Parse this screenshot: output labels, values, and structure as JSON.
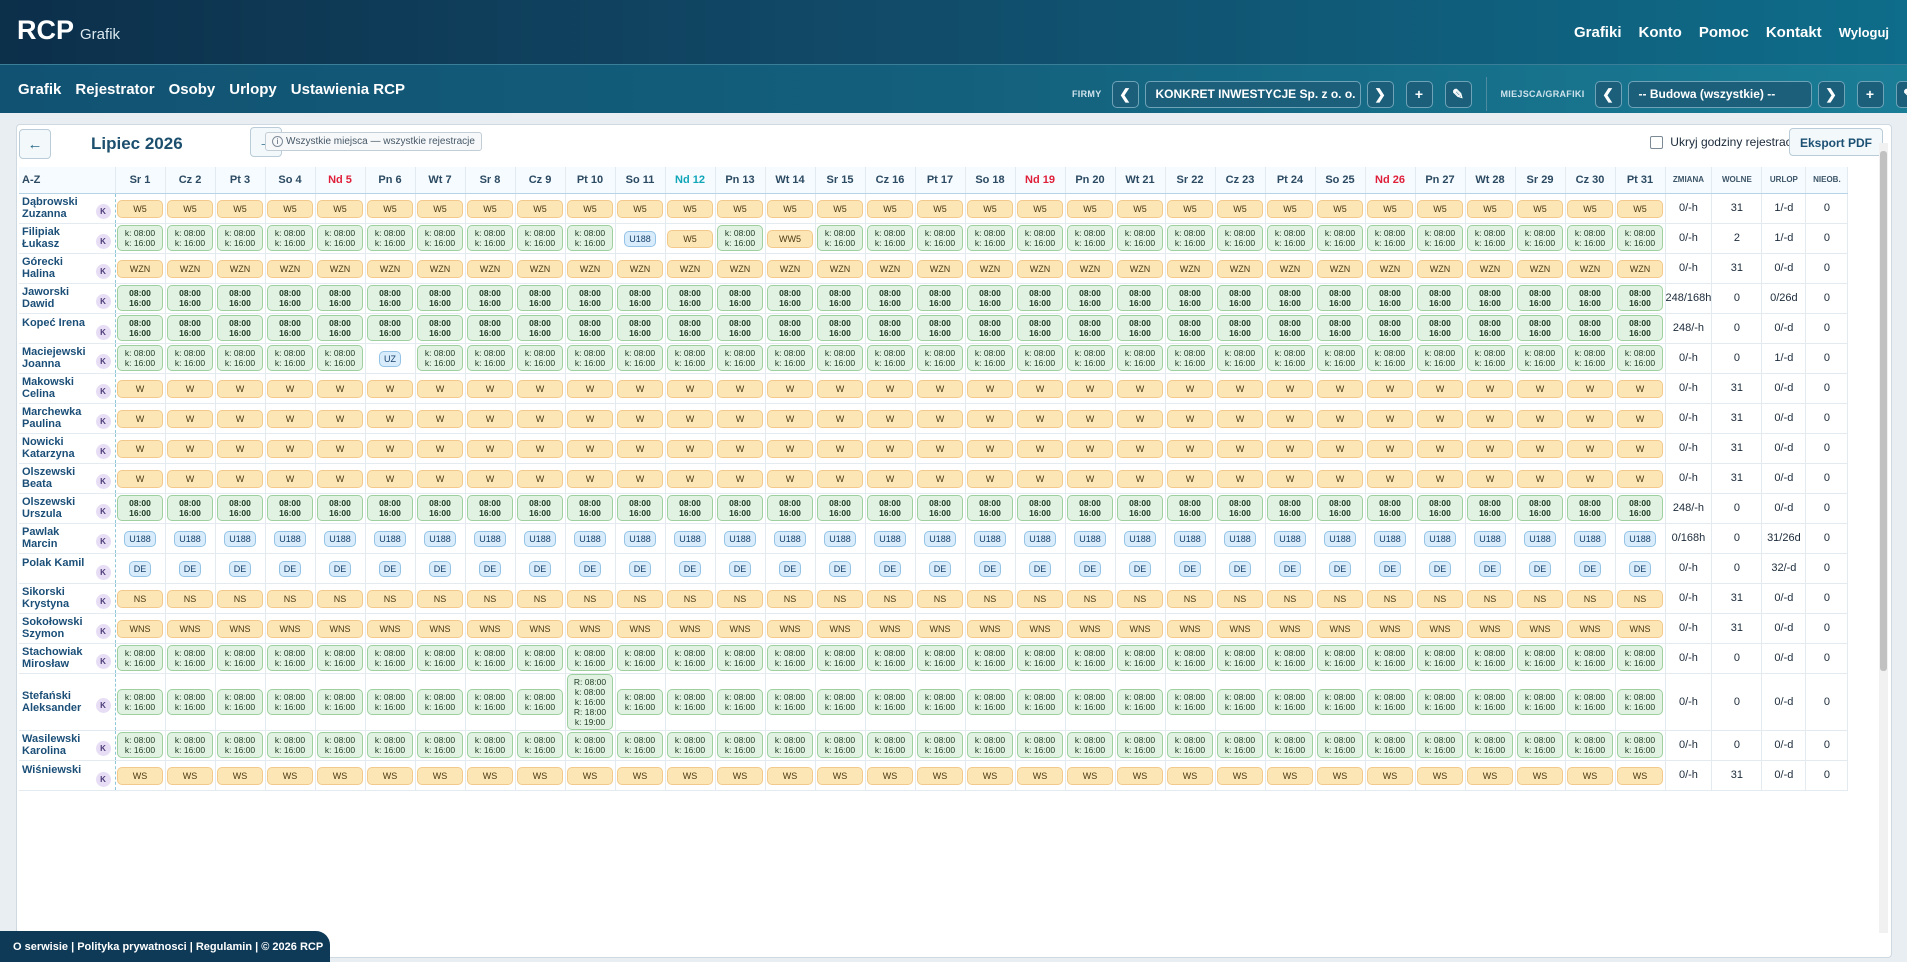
{
  "app": {
    "name": "RCP",
    "subtitle": "Grafik"
  },
  "topnav": [
    "Grafiki",
    "Konto",
    "Pomoc",
    "Kontakt",
    "Wyloguj"
  ],
  "subnav": [
    "Grafik",
    "Rejestrator",
    "Osoby",
    "Urlopy",
    "Ustawienia RCP"
  ],
  "controls": {
    "firmy_label": "FIRMY",
    "firma": "KONKRET INWESTYCJE Sp. z o. o.",
    "miejsca_label": "MIEJSCA/GRAFIKI",
    "miejsce": "-- Budowa (wszystkie) --",
    "prev": "❮",
    "next": "❯",
    "add": "+",
    "edit": "✎"
  },
  "calendar": {
    "month": "Lipiec 2026",
    "prev": "←",
    "next": "→",
    "badge": "Wszystkie miejsca — wszystkie rejestracje",
    "hide_hours": "Ukryj godziny rejestracji",
    "export": "Eksport PDF"
  },
  "columns": {
    "name": "A-Z",
    "summary": [
      "ZMIANA",
      "WOLNE",
      "URLOP",
      "NIEOB."
    ]
  },
  "days": [
    {
      "label": "Sr 1",
      "type": "n"
    },
    {
      "label": "Cz 2",
      "type": "n"
    },
    {
      "label": "Pt 3",
      "type": "n"
    },
    {
      "label": "So 4",
      "type": "n"
    },
    {
      "label": "Nd 5",
      "type": "sun"
    },
    {
      "label": "Pn 6",
      "type": "n"
    },
    {
      "label": "Wt 7",
      "type": "n"
    },
    {
      "label": "Sr 8",
      "type": "n"
    },
    {
      "label": "Cz 9",
      "type": "n"
    },
    {
      "label": "Pt 10",
      "type": "n"
    },
    {
      "label": "So 11",
      "type": "n"
    },
    {
      "label": "Nd 12",
      "type": "today"
    },
    {
      "label": "Pn 13",
      "type": "n"
    },
    {
      "label": "Wt 14",
      "type": "n"
    },
    {
      "label": "Sr 15",
      "type": "n"
    },
    {
      "label": "Cz 16",
      "type": "n"
    },
    {
      "label": "Pt 17",
      "type": "n"
    },
    {
      "label": "So 18",
      "type": "n"
    },
    {
      "label": "Nd 19",
      "type": "sun"
    },
    {
      "label": "Pn 20",
      "type": "n"
    },
    {
      "label": "Wt 21",
      "type": "n"
    },
    {
      "label": "Sr 22",
      "type": "n"
    },
    {
      "label": "Cz 23",
      "type": "n"
    },
    {
      "label": "Pt 24",
      "type": "n"
    },
    {
      "label": "So 25",
      "type": "n"
    },
    {
      "label": "Nd 26",
      "type": "sun"
    },
    {
      "label": "Pn 27",
      "type": "n"
    },
    {
      "label": "Wt 28",
      "type": "n"
    },
    {
      "label": "Sr 29",
      "type": "n"
    },
    {
      "label": "Cz 30",
      "type": "n"
    },
    {
      "label": "Pt 31",
      "type": "n"
    }
  ],
  "person_badge": "K",
  "cell_types": {
    "w": "yellow shift code",
    "g": "green k: shift",
    "g2": "green plain shift",
    "u": "blue absence"
  },
  "rows": [
    {
      "name": "Dąbrowski Zuzanna",
      "default": {
        "t": "w",
        "l": [
          "W5"
        ]
      },
      "overrides": {},
      "sum": [
        "0/-h",
        "31",
        "1/-d",
        "0"
      ]
    },
    {
      "name": "Filipiak Łukasz",
      "default": {
        "t": "g",
        "l": [
          "k: 08:00",
          "k: 16:00"
        ]
      },
      "overrides": {
        "10": {
          "t": "u",
          "l": [
            "U188"
          ]
        },
        "11": {
          "t": "w",
          "l": [
            "W5"
          ]
        },
        "13": {
          "t": "w",
          "l": [
            "WW5"
          ]
        }
      },
      "sum": [
        "0/-h",
        "2",
        "1/-d",
        "0"
      ]
    },
    {
      "name": "Górecki Halina",
      "default": {
        "t": "w",
        "l": [
          "WZN"
        ]
      },
      "overrides": {},
      "sum": [
        "0/-h",
        "31",
        "0/-d",
        "0"
      ]
    },
    {
      "name": "Jaworski Dawid",
      "default": {
        "t": "g2",
        "l": [
          "08:00",
          "16:00"
        ]
      },
      "overrides": {},
      "sum": [
        "248/168h",
        "0",
        "0/26d",
        "0"
      ]
    },
    {
      "name": "Kopeć Irena",
      "default": {
        "t": "g2",
        "l": [
          "08:00",
          "16:00"
        ]
      },
      "overrides": {},
      "sum": [
        "248/-h",
        "0",
        "0/-d",
        "0"
      ]
    },
    {
      "name": "Maciejewski Joanna",
      "default": {
        "t": "g",
        "l": [
          "k: 08:00",
          "k: 16:00"
        ]
      },
      "overrides": {
        "5": {
          "t": "u",
          "l": [
            "UZ"
          ]
        }
      },
      "sum": [
        "0/-h",
        "0",
        "1/-d",
        "0"
      ]
    },
    {
      "name": "Makowski Celina",
      "default": {
        "t": "w",
        "l": [
          "W"
        ]
      },
      "overrides": {},
      "sum": [
        "0/-h",
        "31",
        "0/-d",
        "0"
      ]
    },
    {
      "name": "Marchewka Paulina",
      "default": {
        "t": "w",
        "l": [
          "W"
        ]
      },
      "overrides": {},
      "sum": [
        "0/-h",
        "31",
        "0/-d",
        "0"
      ]
    },
    {
      "name": "Nowicki Katarzyna",
      "default": {
        "t": "w",
        "l": [
          "W"
        ]
      },
      "overrides": {},
      "sum": [
        "0/-h",
        "31",
        "0/-d",
        "0"
      ]
    },
    {
      "name": "Olszewski Beata",
      "default": {
        "t": "w",
        "l": [
          "W"
        ]
      },
      "overrides": {},
      "sum": [
        "0/-h",
        "31",
        "0/-d",
        "0"
      ]
    },
    {
      "name": "Olszewski Urszula",
      "default": {
        "t": "g2",
        "l": [
          "08:00",
          "16:00"
        ]
      },
      "overrides": {},
      "sum": [
        "248/-h",
        "0",
        "0/-d",
        "0"
      ]
    },
    {
      "name": "Pawlak Marcin",
      "default": {
        "t": "u",
        "l": [
          "U188"
        ]
      },
      "overrides": {},
      "sum": [
        "0/168h",
        "0",
        "31/26d",
        "0"
      ]
    },
    {
      "name": "Polak Kamil",
      "default": {
        "t": "u",
        "l": [
          "DE"
        ]
      },
      "overrides": {},
      "sum": [
        "0/-h",
        "0",
        "32/-d",
        "0"
      ]
    },
    {
      "name": "Sikorski Krystyna",
      "default": {
        "t": "w",
        "l": [
          "NS"
        ]
      },
      "overrides": {},
      "sum": [
        "0/-h",
        "31",
        "0/-d",
        "0"
      ]
    },
    {
      "name": "Sokołowski Szymon",
      "default": {
        "t": "w",
        "l": [
          "WNS"
        ]
      },
      "overrides": {},
      "sum": [
        "0/-h",
        "31",
        "0/-d",
        "0"
      ]
    },
    {
      "name": "Stachowiak Mirosław",
      "default": {
        "t": "g",
        "l": [
          "k: 08:00",
          "k: 16:00"
        ]
      },
      "overrides": {},
      "sum": [
        "0/-h",
        "0",
        "0/-d",
        "0"
      ]
    },
    {
      "name": "Stefański Aleksander",
      "default": {
        "t": "g",
        "l": [
          "k: 08:00",
          "k: 16:00"
        ]
      },
      "overrides": {
        "9": {
          "t": "g",
          "l": [
            "R: 08:00",
            "k: 08:00",
            "k: 16:00",
            "R: 18:00",
            "k: 19:00"
          ]
        }
      },
      "sum": [
        "0/-h",
        "0",
        "0/-d",
        "0"
      ]
    },
    {
      "name": "Wasilewski Karolina",
      "default": {
        "t": "g",
        "l": [
          "k: 08:00",
          "k: 16:00"
        ]
      },
      "overrides": {},
      "sum": [
        "0/-h",
        "0",
        "0/-d",
        "0"
      ]
    },
    {
      "name": "Wiśniewski",
      "default": {
        "t": "w",
        "l": [
          "WS"
        ]
      },
      "overrides": {},
      "sum": [
        "0/-h",
        "31",
        "0/-d",
        "0"
      ]
    }
  ],
  "footer": "O serwisie | Polityka prywatnosci | Regulamin | © 2026 RCP"
}
